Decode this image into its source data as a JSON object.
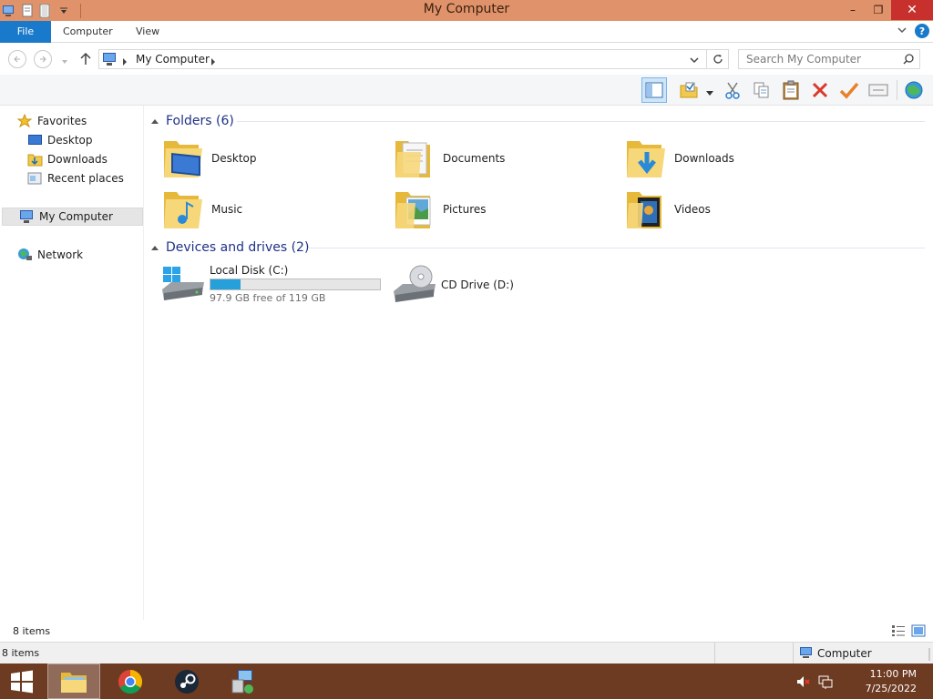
{
  "window": {
    "title": "My Computer"
  },
  "title_buttons": {
    "minimize": "–",
    "maximize": "❐",
    "close": "✕"
  },
  "ribbon": {
    "file": "File",
    "tabs": [
      "Computer",
      "View"
    ]
  },
  "address": {
    "path": "My Computer",
    "search_placeholder": "Search My Computer"
  },
  "nav": {
    "favorites": "Favorites",
    "fav_items": [
      "Desktop",
      "Downloads",
      "Recent places"
    ],
    "my_computer": "My Computer",
    "network": "Network"
  },
  "content": {
    "folders_header": "Folders (6)",
    "folders": [
      "Desktop",
      "Documents",
      "Downloads",
      "Music",
      "Pictures",
      "Videos"
    ],
    "drives_header": "Devices and drives (2)",
    "drives": [
      {
        "name": "Local Disk (C:)",
        "free": "97.9 GB free of 119 GB",
        "used_fraction": 0.18
      },
      {
        "name": "CD Drive (D:)"
      }
    ]
  },
  "status": {
    "items_top": "8 items",
    "items_bottom": "8 items",
    "location": "Computer"
  },
  "taskbar": {
    "time": "11:00 PM",
    "date": "7/25/2022"
  },
  "colors": {
    "titlebar": "#e0936a",
    "accent": "#1979ca",
    "taskbar": "#6d3a22",
    "close": "#c7302c"
  }
}
